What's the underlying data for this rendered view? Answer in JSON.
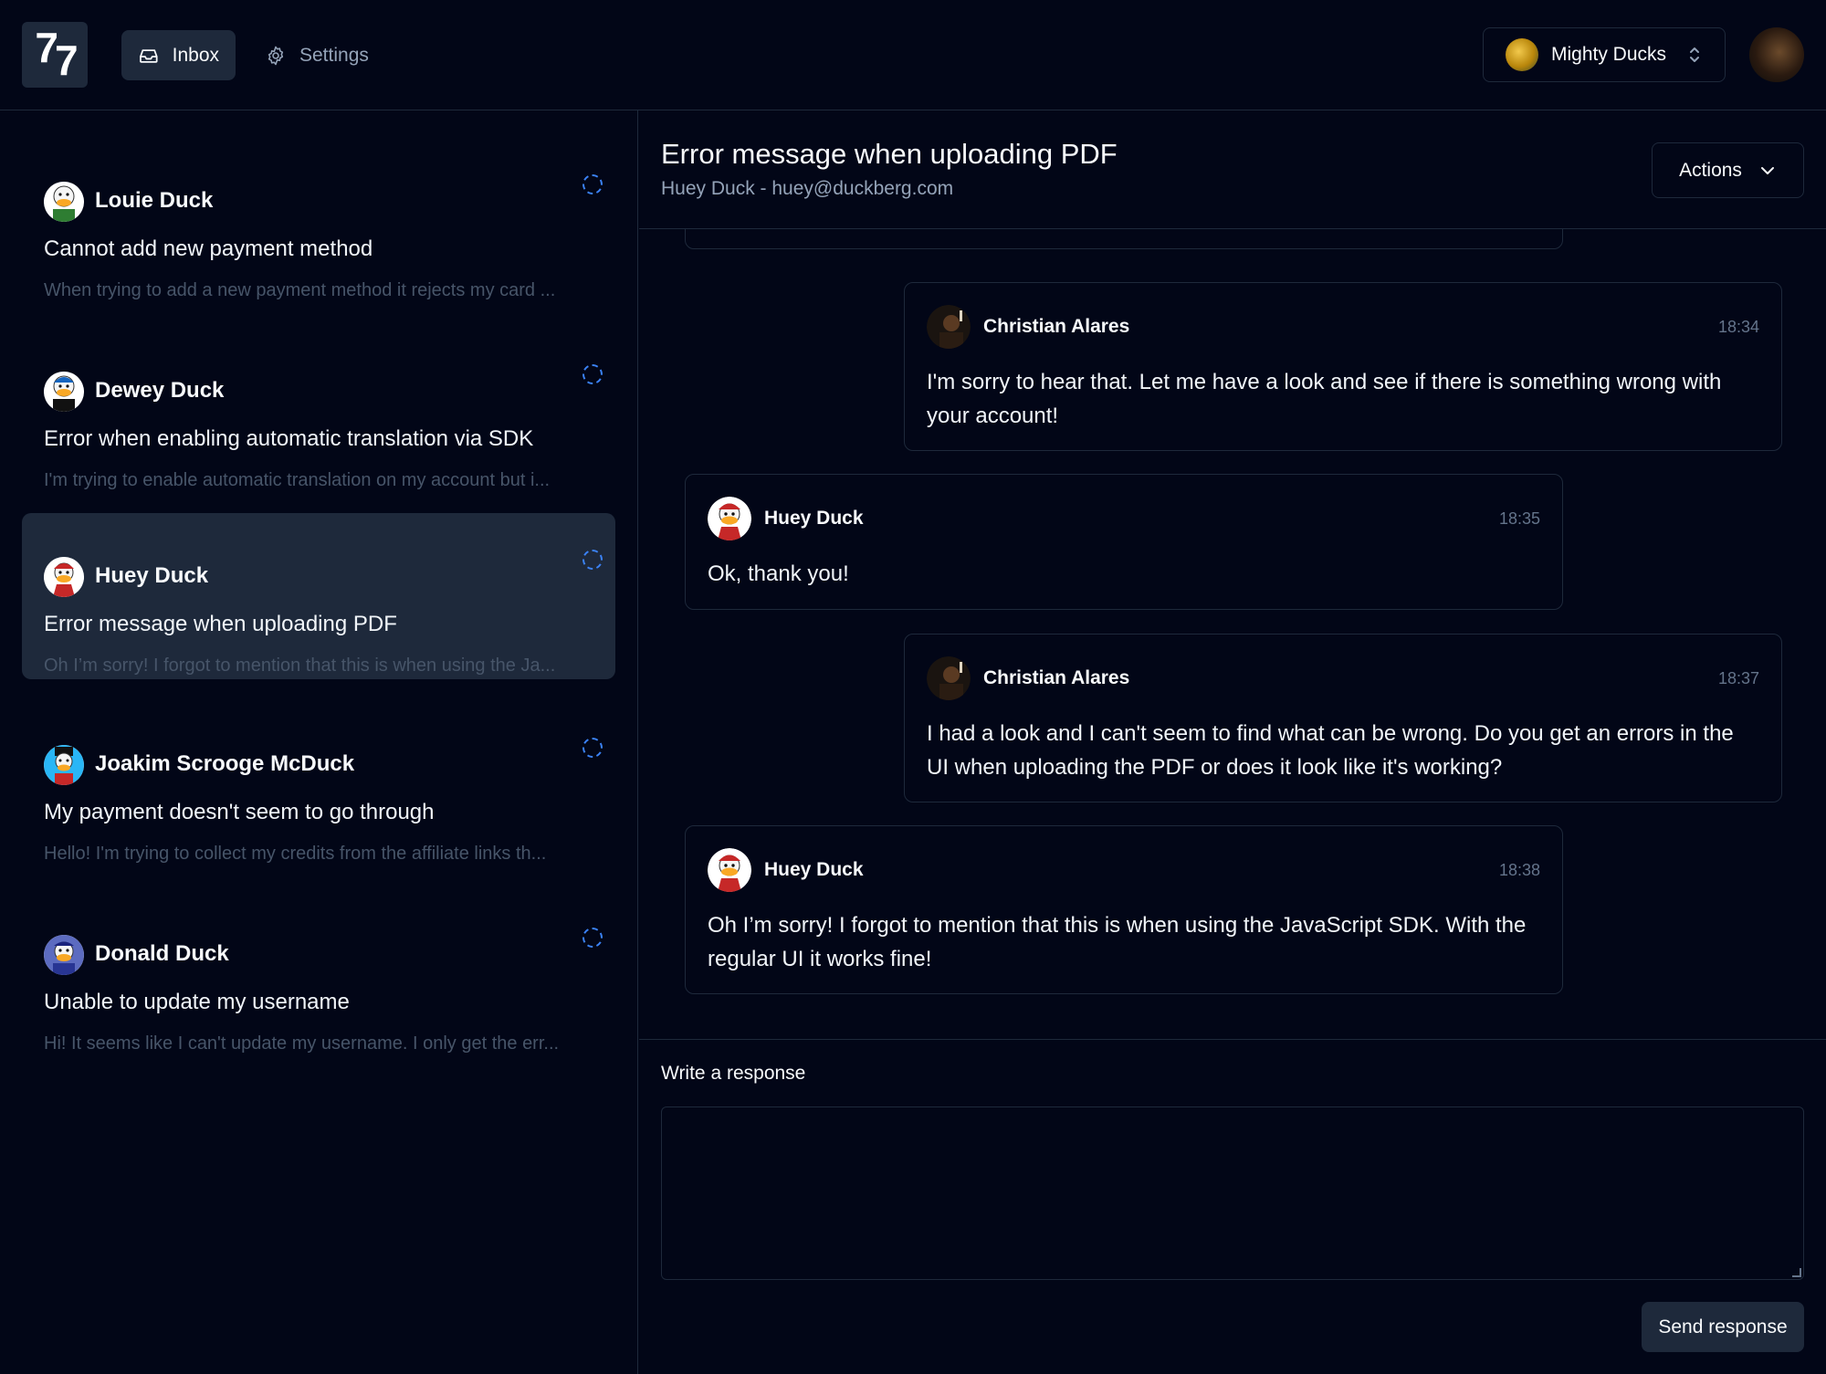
{
  "app": {
    "logo_text_1": "7",
    "logo_text_2": "7"
  },
  "nav": {
    "inbox_label": "Inbox",
    "settings_label": "Settings"
  },
  "team_switcher": {
    "label": "Mighty Ducks"
  },
  "tickets": [
    {
      "name": "Louie Duck",
      "subject": "Cannot add new payment method",
      "preview": "When trying to add a new payment method it rejects my card ...",
      "avatar_color": "#2e7d32"
    },
    {
      "name": "Dewey Duck",
      "subject": "Error when enabling automatic translation via SDK",
      "preview": "I'm trying to enable automatic translation on my account but i...",
      "avatar_color": "#1565c0"
    },
    {
      "name": "Huey Duck",
      "subject": "Error message when uploading PDF",
      "preview": "Oh I’m sorry! I forgot to mention that this is when using the Ja...",
      "avatar_color": "#c62828"
    },
    {
      "name": "Joakim Scrooge McDuck",
      "subject": "My payment doesn't seem to go through",
      "preview": "Hello! I'm trying to collect my credits from the affiliate links th...",
      "avatar_color": "#1e88e5"
    },
    {
      "name": "Donald Duck",
      "subject": "Unable to update my username",
      "preview": "Hi! It seems like I can't update my username. I only get the err...",
      "avatar_color": "#283593"
    }
  ],
  "conversation": {
    "title": "Error message when uploading PDF",
    "subtitle": "Huey Duck - huey@duckberg.com",
    "actions_label": "Actions",
    "messages": [
      {
        "author": "Christian Alares",
        "time": "18:34",
        "body": "I'm sorry to hear that. Let me have a look and see if there is something wrong with your account!"
      },
      {
        "author": "Huey Duck",
        "time": "18:35",
        "body": "Ok, thank you!"
      },
      {
        "author": "Christian Alares",
        "time": "18:37",
        "body": "I had a look and I can't seem to find what can be wrong. Do you get an errors in the UI when uploading the PDF or does it look like it's working?"
      },
      {
        "author": "Huey Duck",
        "time": "18:38",
        "body": "Oh I’m sorry! I forgot to mention that this is when using the JavaScript SDK. With the regular UI it works fine!"
      }
    ]
  },
  "reply": {
    "label": "Write a response",
    "value": "",
    "send_label": "Send response"
  },
  "colors": {
    "background": "#020617",
    "border": "#1e293b",
    "selected": "#1e293b",
    "status_ring": "#3b82f6",
    "muted_text": "#94a3b8"
  }
}
